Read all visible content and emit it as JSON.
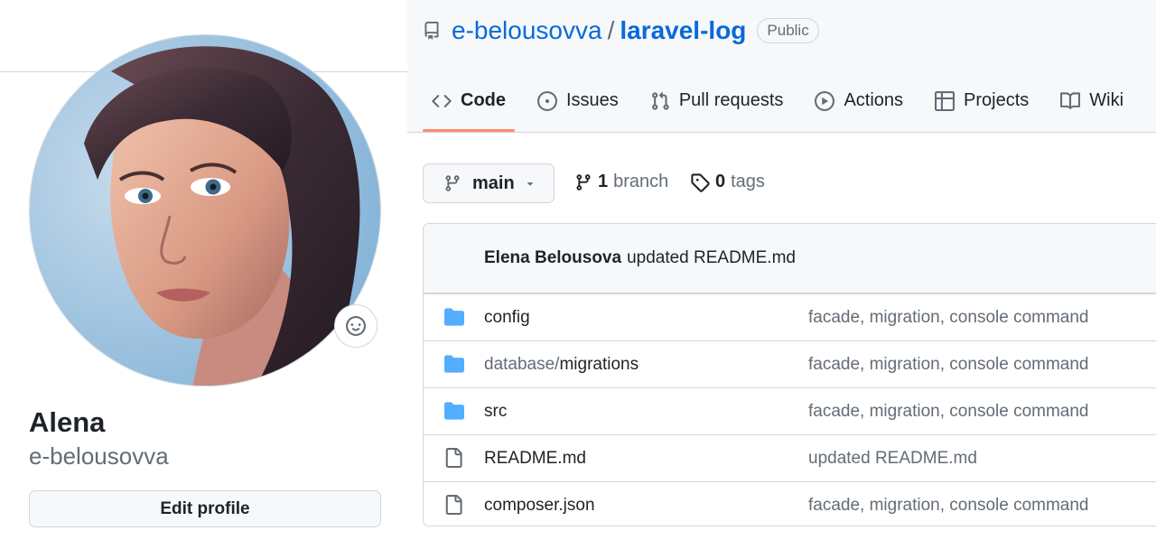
{
  "profile": {
    "name": "Alena",
    "login": "e-belousovva",
    "edit_button": "Edit profile"
  },
  "repo": {
    "owner": "e-belousovva",
    "separator": "/",
    "name": "laravel-log",
    "visibility": "Public"
  },
  "tabs": [
    {
      "label": "Code",
      "icon": "code-icon",
      "selected": true
    },
    {
      "label": "Issues",
      "icon": "issue-opened-icon"
    },
    {
      "label": "Pull requests",
      "icon": "git-pull-request-icon"
    },
    {
      "label": "Actions",
      "icon": "play-icon"
    },
    {
      "label": "Projects",
      "icon": "table-icon"
    },
    {
      "label": "Wiki",
      "icon": "book-icon"
    }
  ],
  "branch": {
    "current": "main",
    "branch_count": "1",
    "branch_word": "branch",
    "tag_count": "0",
    "tag_word": "tags"
  },
  "latest_commit": {
    "author": "Elena Belousova",
    "message": "updated README.md"
  },
  "files": [
    {
      "type": "dir",
      "name": "config",
      "message": "facade, migration, console command"
    },
    {
      "type": "dir",
      "dir_prefix": "database/",
      "name": "migrations",
      "message": "facade, migration, console command"
    },
    {
      "type": "dir",
      "name": "src",
      "message": "facade, migration, console command"
    },
    {
      "type": "file",
      "name": "README.md",
      "message": "updated README.md"
    },
    {
      "type": "file",
      "name": "composer.json",
      "message": "facade, migration, console command"
    }
  ],
  "colors": {
    "link": "#0969da",
    "folder": "#54aeff",
    "selected_tab_underline": "#fd8c73",
    "muted_text": "#636c76",
    "border": "#d0d7de"
  }
}
